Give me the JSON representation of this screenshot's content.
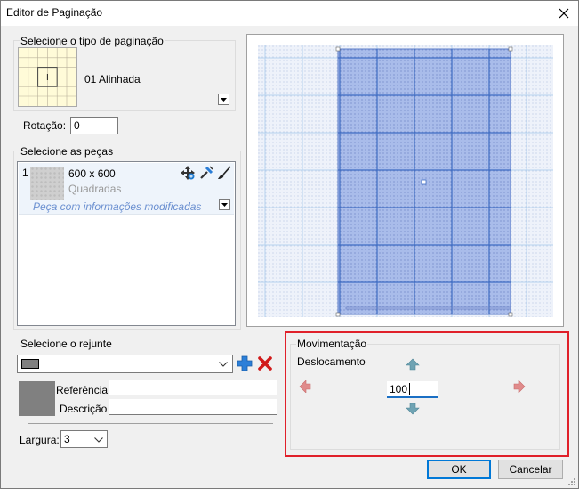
{
  "window": {
    "title": "Editor de Paginação"
  },
  "pagination_type": {
    "group_label": "Selecione o tipo de paginação",
    "selected": "01 Alinhada",
    "rotation_label": "Rotação:",
    "rotation_value": "0"
  },
  "pieces": {
    "group_label": "Selecione as peças",
    "items": [
      {
        "index": "1",
        "size": "600 x 600",
        "type": "Quadradas",
        "status": "Peça com informações modificadas"
      }
    ]
  },
  "grout": {
    "group_label": "Selecione o rejunte",
    "color": "#808080",
    "reference_label": "Referência",
    "reference_value": "",
    "description_label": "Descrição",
    "description_value": "",
    "width_label": "Largura:",
    "width_value": "3"
  },
  "movement": {
    "group_label": "Movimentação",
    "displacement_label": "Deslocamento",
    "displacement_value": "100"
  },
  "buttons": {
    "ok": "OK",
    "cancel": "Cancelar"
  },
  "icons": {
    "close": "close-icon",
    "add_grout": "plus-icon",
    "remove_grout": "red-x-icon",
    "move_arrows": [
      "arrow-up-icon",
      "arrow-down-icon",
      "arrow-left-icon",
      "arrow-right-icon"
    ]
  }
}
